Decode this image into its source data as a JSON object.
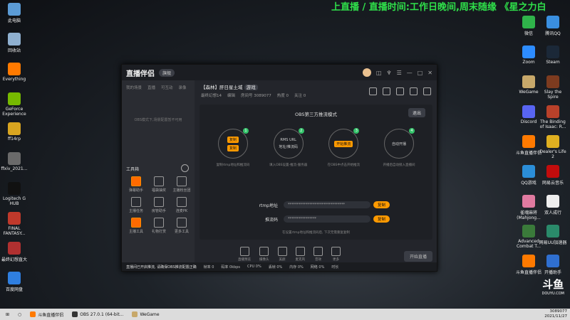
{
  "banner_text": "上直播 / 直播时间:工作日晚间,周末随缘 《星之力白",
  "desktop_left": [
    {
      "label": "此电脑",
      "color": "#5b9bd5"
    },
    {
      "label": "回收站",
      "color": "#8fb0d0"
    },
    {
      "label": "Everything",
      "color": "#ff7a00"
    },
    {
      "label": "GeForce Experience",
      "color": "#76b900"
    },
    {
      "label": "ff14rp",
      "color": "#d9a520"
    },
    {
      "label": "ffxiv_2021...",
      "color": "#6a6a6a"
    },
    {
      "label": "Logitech G HUB",
      "color": "#111"
    },
    {
      "label": "FINAL FANTASY...",
      "color": "#c0392b"
    },
    {
      "label": "最终幻想直大",
      "color": "#b03030"
    },
    {
      "label": "百度网盘",
      "color": "#2f7fe0"
    }
  ],
  "desktop_right": [
    {
      "label": "微信",
      "color": "#2fb34a"
    },
    {
      "label": "腾讯QQ",
      "color": "#3a8fe0"
    },
    {
      "label": "Zoom",
      "color": "#2d8cff"
    },
    {
      "label": "Steam",
      "color": "#1b2838"
    },
    {
      "label": "WeGame",
      "color": "#c7a86a"
    },
    {
      "label": "Slay the Spire",
      "color": "#7d3b1f"
    },
    {
      "label": "Discord",
      "color": "#5865f2"
    },
    {
      "label": "The Binding of Isaac: R...",
      "color": "#b9412a"
    },
    {
      "label": "斗鱼直播伴侣",
      "color": "#ff7a00"
    },
    {
      "label": "Dealer's Life 2",
      "color": "#e0b020"
    },
    {
      "label": "QQ游戏",
      "color": "#2b8ed8"
    },
    {
      "label": "网易云音乐",
      "color": "#c20c0c"
    },
    {
      "label": "雀魂麻将 (Mahjong...",
      "color": "#e07aa0"
    },
    {
      "label": "双人成行",
      "color": "#eee"
    },
    {
      "label": "Advanced Combat T...",
      "color": "#3a7a3a"
    },
    {
      "label": "网易UU加速器",
      "color": "#2a8a6a"
    },
    {
      "label": "斗鱼直播伴侣",
      "color": "#ff7a00"
    },
    {
      "label": "开播助手",
      "color": "#2f6fd0"
    }
  ],
  "app": {
    "logo": "直播伴侣",
    "version_badge": "旗舰",
    "side_tabs": [
      "我的场景",
      "直播",
      "可互动",
      "录像"
    ],
    "side_empty": "OBS模式下,场景配置暂不可用",
    "tools_title": "工具箱",
    "tools": [
      "弹幕助手",
      "福袋抽奖",
      "主播粉丝团",
      "主播任务",
      "房管助手",
      "连麦PK",
      "主播工具",
      "礼物打赏",
      "更多工具"
    ],
    "room_title": "【森林】肝日星土域",
    "room_tag": "游戏",
    "room_category": "最终幻想14",
    "room_edit": "编辑",
    "room_meta": [
      "房间号 3089077",
      "热度 0",
      "关注 0"
    ],
    "obs_title": "OBS第三方推流模式",
    "exit_label": "退出",
    "steps": [
      {
        "buttons": [
          "复制",
          "复制"
        ],
        "desc": "复制rtmp地址和推流码"
      },
      {
        "lines": [
          "RMS URL",
          "地址/推流码"
        ],
        "desc": "填入OBS设置-推流-服务器"
      },
      {
        "buttons": [
          "开始推流"
        ],
        "desc": "在OBS中点击开始推流"
      },
      {
        "lines": [
          "自动开播"
        ],
        "desc": "开播后自动接入直播间"
      }
    ],
    "rtmp_label": "rtmp地址",
    "rtmp_value": "********************************",
    "key_label": "推流码",
    "key_value": "****************",
    "copy_label": "复制",
    "hint": "在设置rtmp地址和推流码后, 下次无需重复复制",
    "toolbar": [
      "直播预览",
      "摄像头",
      "美颜",
      "麦克风",
      "音效",
      "更多"
    ],
    "start_label": "开始直播",
    "status_notice": "直播间已开启推流, 请确保OBS推流配置正确",
    "status_items": [
      "帧率 0",
      "码率 0kbps",
      "CPU 0%",
      "丢帧 0%",
      "内存 0%",
      "网络 0%",
      "时长"
    ]
  },
  "taskbar": [
    {
      "label": "斗鱼直播伴侣",
      "color": "#ff7a00"
    },
    {
      "label": "OBS 27.0.1 (64-bit...",
      "color": "#333"
    },
    {
      "label": "WeGame",
      "color": "#c7a86a"
    }
  ],
  "clock": {
    "time": "3089077",
    "date": "2021/11/27"
  },
  "douyu": {
    "logo": "斗鱼",
    "domain": "DOUYU.COM"
  }
}
